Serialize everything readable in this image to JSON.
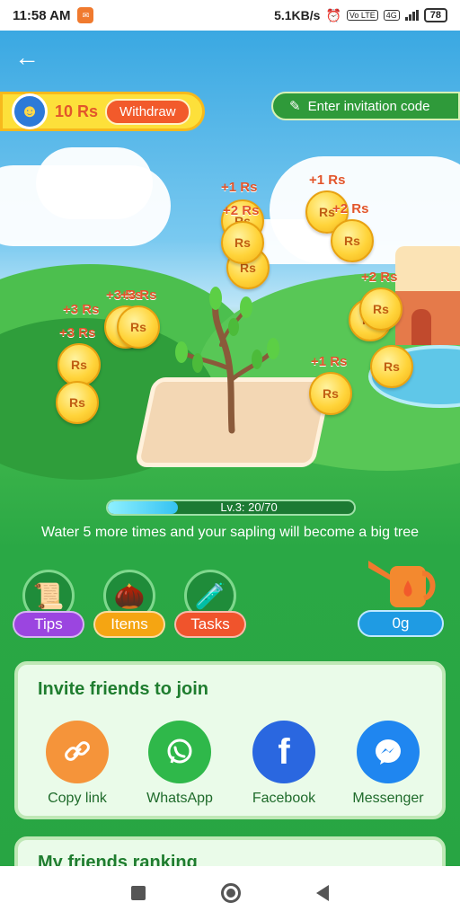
{
  "status_bar": {
    "time": "11:58 AM",
    "net_speed": "5.1KB/s",
    "vo_lte": "Vo LTE",
    "network": "4G",
    "battery": "78"
  },
  "header": {
    "balance": "10 Rs",
    "withdraw_label": "Withdraw",
    "invite_code_label": "Enter invitation code"
  },
  "coins": [
    {
      "label": "+1 Rs",
      "coin": "Rs"
    },
    {
      "label": "+2 Rs",
      "coin": "Rs"
    },
    {
      "label": "+1 Rs",
      "coin": "Rs"
    },
    {
      "label": "+2 Rs",
      "coin": "Rs"
    },
    {
      "label": "+1 Rs",
      "coin": "Rs"
    },
    {
      "label": "+3 Rs",
      "coin": "Rs"
    },
    {
      "label": "+3 Rs",
      "coin": "Rs"
    },
    {
      "label": "+3 Rs",
      "coin": "Rs"
    },
    {
      "label": "+2 Rs",
      "coin": "Rs"
    },
    {
      "label": "+1 Rs",
      "coin": "Rs"
    },
    {
      "label": "+1 Rs",
      "coin": "Rs"
    }
  ],
  "progress": {
    "label": "Lv.3: 20/70",
    "fraction": 0.286
  },
  "water_hint": "Water 5 more times and your sapling will become a big tree",
  "features": {
    "tips": "Tips",
    "items": "Items",
    "tasks": "Tasks",
    "water_amount": "0g"
  },
  "invite": {
    "title": "Invite friends to join",
    "copy_link": "Copy link",
    "whatsapp": "WhatsApp",
    "facebook": "Facebook",
    "messenger": "Messenger"
  },
  "ranking": {
    "title": "My friends ranking"
  },
  "colors": {
    "accent_green": "#2aa845",
    "withdraw": "#f25a2b",
    "coin": "#ffd43a",
    "tips": "#9b45e0",
    "items": "#f5a512",
    "tasks": "#f0542c"
  }
}
